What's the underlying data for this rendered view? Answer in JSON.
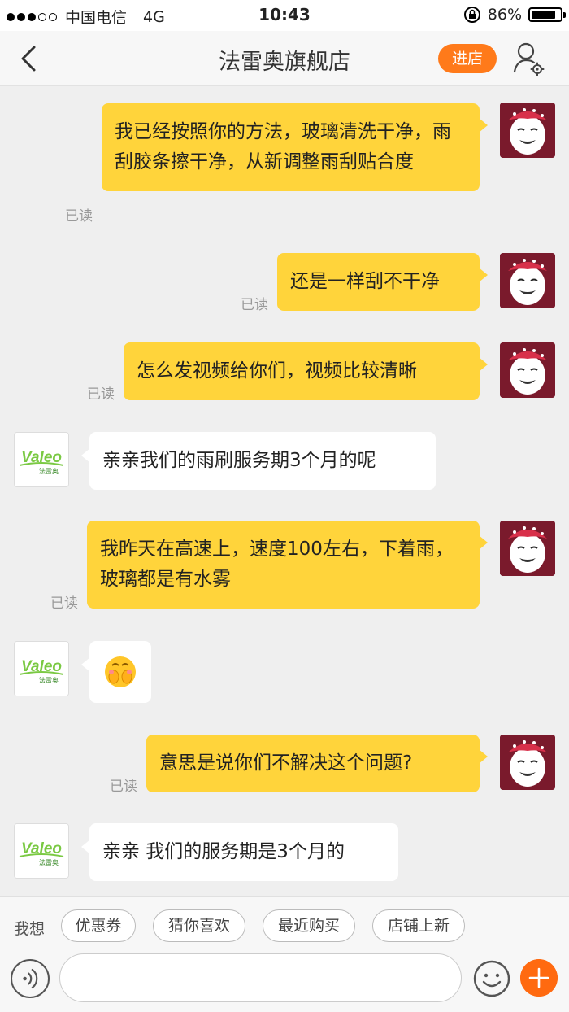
{
  "status_bar": {
    "carrier": "中国电信",
    "network": "4G",
    "time": "10:43",
    "battery": "86%",
    "battery_level": 0.86
  },
  "nav": {
    "title": "法雷奥旗舰店",
    "store_button": "进店"
  },
  "messages": [
    {
      "from": "me",
      "text": "我已经按照你的方法，玻璃清洗干净，雨刮胶条擦干净，从新调整雨刮贴合度",
      "status": "已读"
    },
    {
      "from": "me",
      "text": "还是一样刮不干净",
      "status": "已读"
    },
    {
      "from": "me",
      "text": "怎么发视频给你们，视频比较清晰",
      "status": "已读"
    },
    {
      "from": "shop",
      "text": "亲亲我们的雨刷服务期3个月的呢"
    },
    {
      "from": "me",
      "text": "我昨天在高速上，速度100左右，下着雨，玻璃都是有水雾",
      "status": "已读"
    },
    {
      "from": "shop",
      "text": "",
      "emoji": "smiley-emoji"
    },
    {
      "from": "me",
      "text": "意思是说你们不解决这个问题?",
      "status": "已读"
    },
    {
      "from": "shop",
      "text": "亲亲 我们的服务期是3个月的"
    }
  ],
  "shop_avatar": {
    "brand": "Valeo",
    "brand_cn": "法雷奥"
  },
  "suggestions": {
    "label": "我想",
    "chips": [
      "优惠券",
      "猜你喜欢",
      "最近购买",
      "店铺上新"
    ]
  },
  "colors": {
    "my_bubble": "#ffd43b",
    "accent": "#ff7a1a",
    "valeo_green": "#7ac943"
  }
}
